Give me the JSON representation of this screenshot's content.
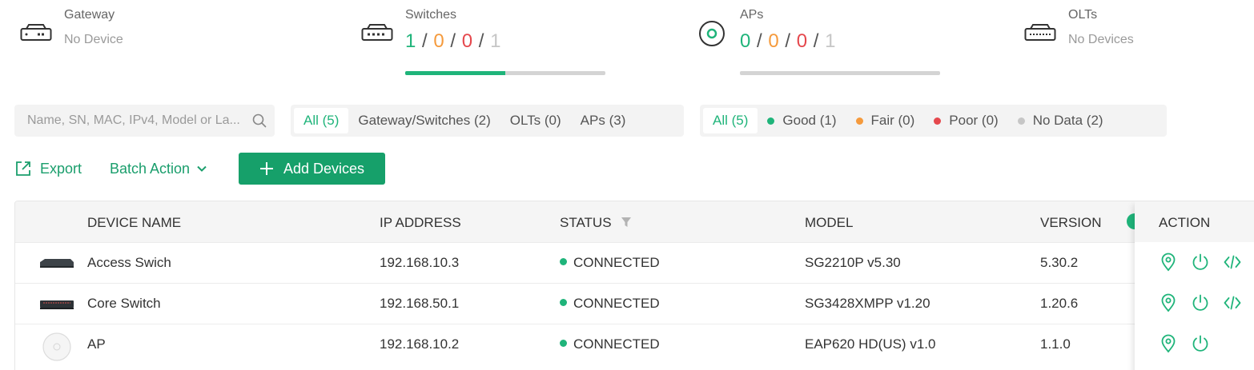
{
  "summary": {
    "gateway": {
      "title": "Gateway",
      "subtitle": "No Device",
      "icon": "gateway-icon"
    },
    "switches": {
      "title": "Switches",
      "counts": [
        "1",
        "0",
        "0",
        "1"
      ],
      "progress": 0.5,
      "icon": "switch-icon"
    },
    "aps": {
      "title": "APs",
      "counts": [
        "0",
        "0",
        "0",
        "1"
      ],
      "progress": 0,
      "icon": "ap-icon"
    },
    "olts": {
      "title": "OLTs",
      "subtitle": "No Devices",
      "icon": "olt-icon"
    },
    "colors": {
      "connected": "#1fb47a",
      "pending": "#f59a3c",
      "disconnected": "#e5484d",
      "isolated": "#c6c6c6"
    }
  },
  "search": {
    "placeholder": "Name, SN, MAC, IPv4, Model or La..."
  },
  "type_filter": {
    "all": "All (5)",
    "gateway_switches": "Gateway/Switches (2)",
    "olts": "OLTs (0)",
    "aps": "APs (3)"
  },
  "health_filter": {
    "all": "All (5)",
    "good": "Good (1)",
    "fair": "Fair (0)",
    "poor": "Poor (0)",
    "no_data": "No Data (2)",
    "colors": {
      "good": "#1fb47a",
      "fair": "#f59a3c",
      "poor": "#e5484d",
      "no_data": "#c6c6c6"
    }
  },
  "toolbar": {
    "export": "Export",
    "batch_action": "Batch Action",
    "add_devices": "Add Devices"
  },
  "table": {
    "headers": {
      "device_name": "DEVICE NAME",
      "ip_address": "IP ADDRESS",
      "status": "STATUS",
      "model": "MODEL",
      "version": "VERSION",
      "action": "ACTION"
    },
    "rows": [
      {
        "name": "Access Swich",
        "ip": "192.168.10.3",
        "status": "CONNECTED",
        "model": "SG2210P v5.30",
        "version": "5.30.2"
      },
      {
        "name": "Core Switch",
        "ip": "192.168.50.1",
        "status": "CONNECTED",
        "model": "SG3428XMPP v1.20",
        "version": "1.20.6"
      },
      {
        "name": "AP",
        "ip": "192.168.10.2",
        "status": "CONNECTED",
        "model": "EAP620 HD(US) v1.0",
        "version": "1.1.0"
      }
    ]
  }
}
